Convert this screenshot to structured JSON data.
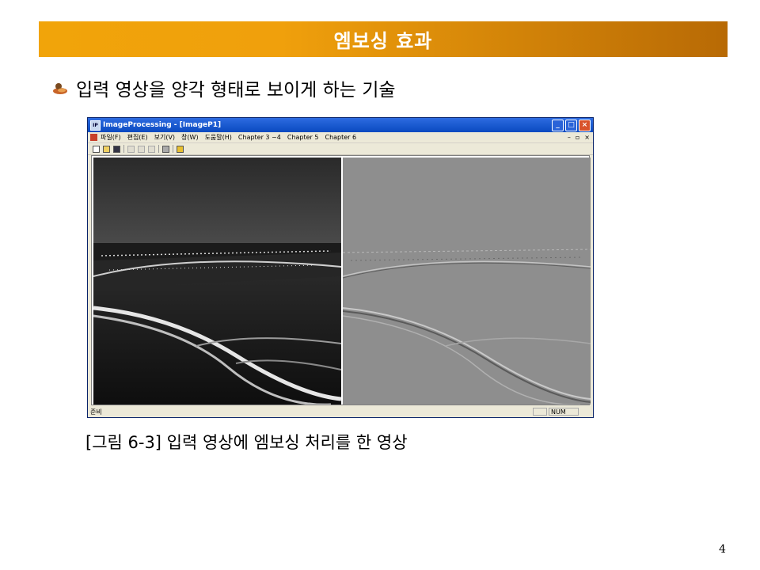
{
  "slide": {
    "title": "엠보싱 효과",
    "bullet": "입력 영상을 양각 형태로 보이게 하는 기술",
    "caption": "[그림 6-3] 입력 영상에 엠보싱 처리를 한 영상",
    "page_number": "4"
  },
  "window": {
    "title": "ImageProcessing - [ImageP1]",
    "menu": [
      "파일(F)",
      "편집(E)",
      "보기(V)",
      "창(W)",
      "도움말(H)",
      "Chapter 3 ~4",
      "Chapter 5",
      "Chapter 6"
    ],
    "status": "준비",
    "num_indicator": "NUM"
  },
  "colors": {
    "title_bar_start": "#f1a40a",
    "title_bar_end": "#b86a05"
  }
}
